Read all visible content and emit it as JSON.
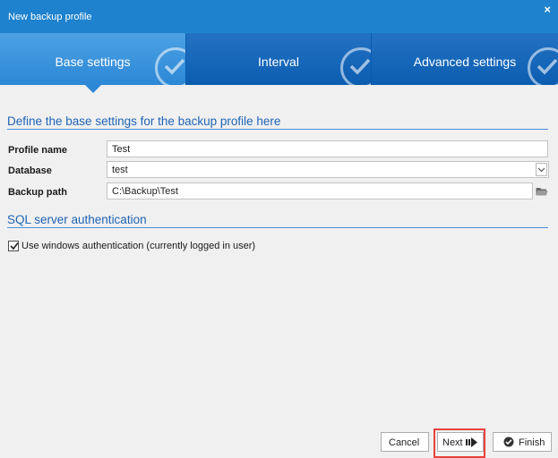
{
  "window": {
    "title": "New backup profile",
    "close_glyph": "×"
  },
  "steps": [
    {
      "label": "Base settings",
      "icon": "check-circle-icon",
      "active": true
    },
    {
      "label": "Interval",
      "icon": "check-circle-icon",
      "active": false
    },
    {
      "label": "Advanced settings",
      "icon": "check-circle-icon",
      "active": false
    }
  ],
  "base_section": {
    "heading": "Define the base settings for the backup profile here"
  },
  "fields": {
    "profile_name": {
      "label": "Profile name",
      "value": "Test"
    },
    "database": {
      "label": "Database",
      "value": "test"
    },
    "backup_path": {
      "label": "Backup path",
      "value": "C:\\Backup\\Test"
    }
  },
  "auth_section": {
    "heading": "SQL server authentication",
    "checkbox_label": "Use windows authentication (currently logged in user)",
    "checked": true
  },
  "buttons": {
    "cancel": "Cancel",
    "next": "Next",
    "finish": "Finish"
  },
  "colors": {
    "titlebar": "#1e82cf",
    "step_active": "#2c87d6",
    "step_inactive": "#0c5db1",
    "section": "#2064b4",
    "highlight": "#e8413b"
  }
}
